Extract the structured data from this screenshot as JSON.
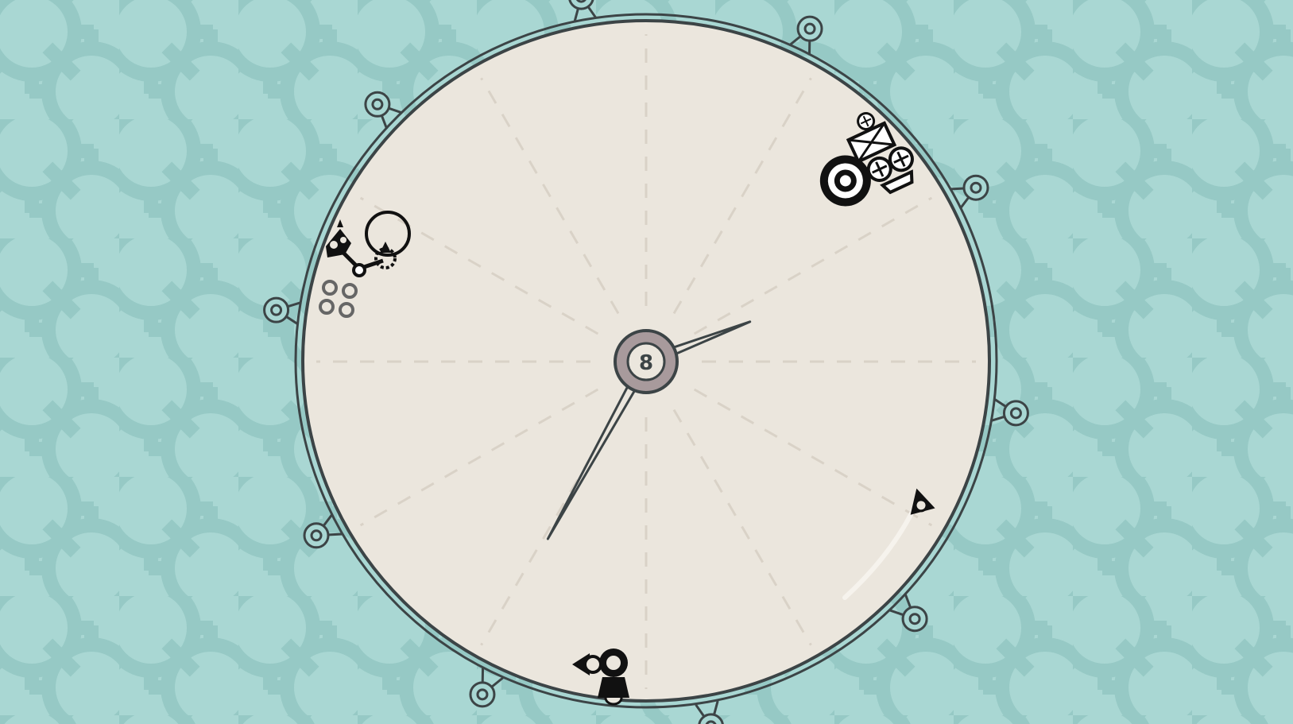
{
  "game": {
    "center_label": "8",
    "hands": [
      {
        "name": "hour-hand",
        "angle_deg": 69
      },
      {
        "name": "minute-hand",
        "angle_deg": 209
      }
    ],
    "anchors_count": 10,
    "colors": {
      "background": "#a9d7d3",
      "gear_pattern": "#8fc4c0",
      "dial_face": "#ebe6dd",
      "outline": "#3c4446",
      "hub": "#a89a9c",
      "ink": "#111111"
    },
    "entities": [
      {
        "name": "player-robot",
        "icon": "robot-with-spikes-icon"
      },
      {
        "name": "balloon-gear-contraption",
        "icon": "gear-balloon-icon"
      },
      {
        "name": "clover-token",
        "icon": "four-ring-clover-icon"
      },
      {
        "name": "snail-cart-machine",
        "icon": "snail-cart-icon"
      },
      {
        "name": "arrow-drone",
        "icon": "triangle-arrow-icon"
      },
      {
        "name": "eye-bell-creature",
        "icon": "eye-bell-icon"
      }
    ]
  }
}
